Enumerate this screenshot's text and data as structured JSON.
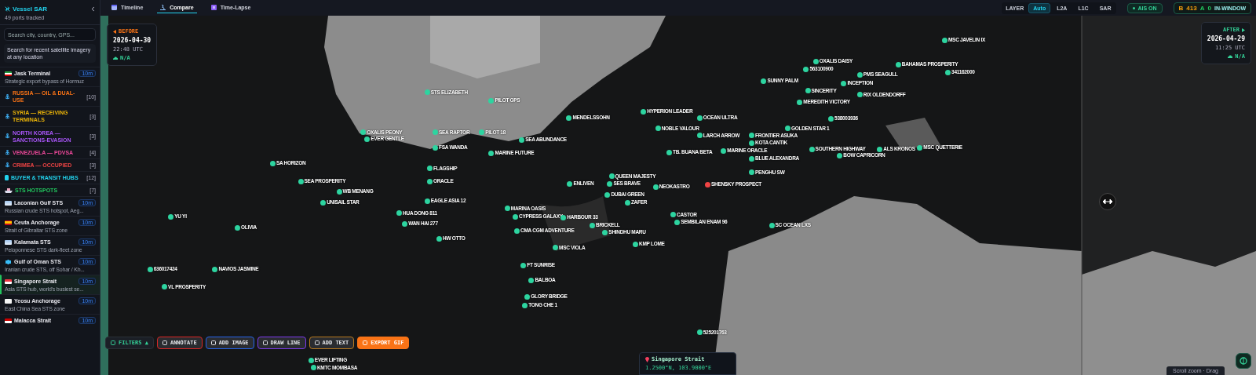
{
  "sidebar": {
    "title": "Vessel SAR",
    "subtitle": "49 ports tracked",
    "search": {
      "placeholder": "Search city, country, GPS..."
    },
    "hint": "Search for recent satellite imagery at any location",
    "items": [
      {
        "kind": "port",
        "name": "Jask Terminal",
        "description": "Strategic export bypass of Hormuz",
        "badge": "10m",
        "selected": false
      },
      {
        "kind": "group",
        "name": "RUSSIA — OIL & DUAL-USE",
        "count": "[10]",
        "color": "#f97316"
      },
      {
        "kind": "group",
        "name": "SYRIA — RECEIVING TERMINALS",
        "count": "[3]",
        "color": "#eab308"
      },
      {
        "kind": "group",
        "name": "NORTH KOREA — SANCTIONS-EVASION",
        "count": "[3]",
        "color": "#a855f7"
      },
      {
        "kind": "group",
        "name": "VENEZUELA — PDVSA",
        "count": "[4]",
        "color": "#ec4899"
      },
      {
        "kind": "group",
        "name": "CRIMEA — OCCUPIED",
        "count": "[3]",
        "color": "#ef4444"
      },
      {
        "kind": "hub",
        "name": "BUYER & TRANSIT HUBS",
        "count": "[12]",
        "color": "#22d3ee"
      },
      {
        "kind": "hotspot",
        "name": "STS HOTSPOTS",
        "count": "[7]",
        "color": "#22c55e"
      },
      {
        "kind": "port",
        "name": "Laconian Gulf STS",
        "description": "Russian crude STS hotspot, Aeg...",
        "badge": "10m",
        "selected": false
      },
      {
        "kind": "port",
        "name": "Ceuta Anchorage",
        "description": "Strait of Gibraltar STS zone",
        "badge": "10m",
        "selected": false
      },
      {
        "kind": "port",
        "name": "Kalamata STS",
        "description": "Peloponnese STS dark-fleet zone",
        "badge": "10m",
        "selected": false
      },
      {
        "kind": "port",
        "name": "Gulf of Oman STS",
        "description": "Iranian crude STS, off Sohar / Kh...",
        "badge": "10m",
        "selected": false
      },
      {
        "kind": "port",
        "name": "Singapore Strait",
        "description": "Asia STS hub, world's busiest se...",
        "badge": "10m",
        "selected": true
      },
      {
        "kind": "port",
        "name": "Yeosu Anchorage",
        "description": "East China Sea STS zone",
        "badge": "10m",
        "selected": false
      },
      {
        "kind": "port",
        "name": "Malacca Strait",
        "badge": "10m",
        "selected": false
      }
    ]
  },
  "tabs": [
    {
      "label": "Timeline",
      "selected": false
    },
    {
      "label": "Compare",
      "selected": true
    },
    {
      "label": "Time-Lapse",
      "selected": false
    }
  ],
  "layer": {
    "label": "LAYER",
    "options": [
      {
        "label": "Auto",
        "selected": true
      },
      {
        "label": "L2A",
        "selected": false
      },
      {
        "label": "L1C",
        "selected": false
      },
      {
        "label": "SAR",
        "selected": false
      }
    ]
  },
  "ais": {
    "label": "AIS ON",
    "on": true
  },
  "counts": [
    {
      "label": "B",
      "value": "413",
      "color": "#f59e0b"
    },
    {
      "label": "A",
      "value": "0",
      "color": "#22c55e"
    }
  ],
  "counts_label": "IN-WINDOW",
  "before": {
    "label": "BEFORE",
    "date": "2026-04-30",
    "time": "22:48 UTC",
    "cloud": "N/A"
  },
  "after": {
    "label": "AFTER",
    "date": "2026-04-29",
    "time": "11:25 UTC",
    "cloud": "N/A"
  },
  "vessels": [
    {
      "name": "MSC JAVELIN IX",
      "color": "#2dd4a0"
    },
    {
      "name": "OXALIS DAISY",
      "color": "#2dd4a0"
    },
    {
      "name": "BAHAMAS PROSPERITY",
      "color": "#2dd4a0"
    },
    {
      "name": "563100900",
      "color": "#2dd4a0"
    },
    {
      "name": "PMS SEAGULL",
      "color": "#2dd4a0"
    },
    {
      "name": "341162000",
      "color": "#2dd4a0"
    },
    {
      "name": "SUNNY PALM",
      "color": "#2dd4a0"
    },
    {
      "name": "INCEPTION",
      "color": "#2dd4a0"
    },
    {
      "name": "STS ELIZABETH",
      "color": "#2dd4a0"
    },
    {
      "name": "SINCERITY",
      "color": "#2dd4a0"
    },
    {
      "name": "RIX OLDENDORFF",
      "color": "#2dd4a0"
    },
    {
      "name": "PILOT GPS",
      "color": "#2dd4a0"
    },
    {
      "name": "MEREDITH VICTORY",
      "color": "#2dd4a0"
    },
    {
      "name": "HYPERION LEADER",
      "color": "#2dd4a0"
    },
    {
      "name": "MENDELSSOHN",
      "color": "#2dd4a0"
    },
    {
      "name": "OCEAN ULTRA",
      "color": "#2dd4a0"
    },
    {
      "name": "538003936",
      "color": "#2dd4a0"
    },
    {
      "name": "NOBLE VALOUR",
      "color": "#2dd4a0"
    },
    {
      "name": "GOLDEN STAR 1",
      "color": "#2dd4a0"
    },
    {
      "name": "OXALIS PEONY",
      "color": "#2dd4a0"
    },
    {
      "name": "SEA RAPTOR",
      "color": "#2dd4a0"
    },
    {
      "name": "PILOT 18",
      "color": "#2dd4a0"
    },
    {
      "name": "LARCH ARROW",
      "color": "#2dd4a0"
    },
    {
      "name": "FRONTIER ASUKA",
      "color": "#2dd4a0"
    },
    {
      "name": "EVER GENTLE",
      "color": "#2dd4a0"
    },
    {
      "name": "SEA ABUNDANCE",
      "color": "#2dd4a0"
    },
    {
      "name": "KOTA CANTIK",
      "color": "#2dd4a0"
    },
    {
      "name": "FSA WANDA",
      "color": "#2dd4a0"
    },
    {
      "name": "MARINE FUTURE",
      "color": "#2dd4a0"
    },
    {
      "name": "TB. BUANA BETA",
      "color": "#2dd4a0"
    },
    {
      "name": "MARINE ORACLE",
      "color": "#2dd4a0"
    },
    {
      "name": "SOUTHERN HIGHWAY",
      "color": "#2dd4a0"
    },
    {
      "name": "ALS KRONOS",
      "color": "#2dd4a0"
    },
    {
      "name": "MSC QUETTERIE",
      "color": "#2dd4a0"
    },
    {
      "name": "BOW CAPRICORN",
      "color": "#2dd4a0"
    },
    {
      "name": "BLUE ALEXANDRA",
      "color": "#2dd4a0"
    },
    {
      "name": "SA HORIZON",
      "color": "#2dd4a0"
    },
    {
      "name": "FLAGSHIP",
      "color": "#2dd4a0"
    },
    {
      "name": "PENGHU SW",
      "color": "#2dd4a0"
    },
    {
      "name": "QUEEN MAJESTY",
      "color": "#2dd4a0"
    },
    {
      "name": "SEA PROSPERITY",
      "color": "#2dd4a0"
    },
    {
      "name": "ORACLE",
      "color": "#2dd4a0"
    },
    {
      "name": "ENLIVEN",
      "color": "#2dd4a0"
    },
    {
      "name": "SES BRAVE",
      "color": "#2dd4a0"
    },
    {
      "name": "NEOKASTRO",
      "color": "#2dd4a0"
    },
    {
      "name": "SHENSKY PROSPECT",
      "color": "#ef4444"
    },
    {
      "name": "WB MENANG",
      "color": "#2dd4a0"
    },
    {
      "name": "DUBAI GREEN",
      "color": "#2dd4a0"
    },
    {
      "name": "UNISAIL STAR",
      "color": "#2dd4a0"
    },
    {
      "name": "EAGLE ASIA 12",
      "color": "#2dd4a0"
    },
    {
      "name": "ZAFER",
      "color": "#2dd4a0"
    },
    {
      "name": "MARINA OASIS",
      "color": "#2dd4a0"
    },
    {
      "name": "YU YI",
      "color": "#2dd4a0"
    },
    {
      "name": "HUA DONG 811",
      "color": "#2dd4a0"
    },
    {
      "name": "CYPRESS GALAXY",
      "color": "#2dd4a0"
    },
    {
      "name": "HARBOUR 33",
      "color": "#2dd4a0"
    },
    {
      "name": "CASTOR",
      "color": "#2dd4a0"
    },
    {
      "name": "OLIVIA",
      "color": "#2dd4a0"
    },
    {
      "name": "WAN HAI 277",
      "color": "#2dd4a0"
    },
    {
      "name": "BRICKELL",
      "color": "#2dd4a0"
    },
    {
      "name": "SEMBILAN ENAM 96",
      "color": "#2dd4a0"
    },
    {
      "name": "SC OCEAN LXS",
      "color": "#2dd4a0"
    },
    {
      "name": "CMA CGM ADVENTURE",
      "color": "#2dd4a0"
    },
    {
      "name": "SHINDHU MARU",
      "color": "#2dd4a0"
    },
    {
      "name": "HW OTTO",
      "color": "#2dd4a0"
    },
    {
      "name": "MSC VIOLA",
      "color": "#2dd4a0"
    },
    {
      "name": "KMP LOME",
      "color": "#2dd4a0"
    },
    {
      "name": "FT SUNRISE",
      "color": "#2dd4a0"
    },
    {
      "name": "636017424",
      "color": "#2dd4a0"
    },
    {
      "name": "NAVIOS JASMINE",
      "color": "#2dd4a0"
    },
    {
      "name": "BALBOA",
      "color": "#2dd4a0"
    },
    {
      "name": "VL PROSPERITY",
      "color": "#2dd4a0"
    },
    {
      "name": "GLORY BRIDGE",
      "color": "#2dd4a0"
    },
    {
      "name": "TONG CHE 1",
      "color": "#2dd4a0"
    },
    {
      "name": "525201763",
      "color": "#2dd4a0"
    },
    {
      "name": "EVER LIFTING",
      "color": "#2dd4a0"
    },
    {
      "name": "KMTC MOMBASA",
      "color": "#2dd4a0"
    }
  ],
  "tools": [
    {
      "kind": "filters",
      "label": "FILTERS ▲"
    },
    {
      "kind": "annotate",
      "label": "ANNOTATE"
    },
    {
      "kind": "image",
      "label": "ADD IMAGE"
    },
    {
      "kind": "line",
      "label": "DRAW LINE"
    },
    {
      "kind": "text",
      "label": "ADD TEXT"
    },
    {
      "kind": "export",
      "label": "EXPORT GIF"
    }
  ],
  "location": {
    "name": "Singapore Strait",
    "coords": "1.2500°N, 103.9000°E"
  },
  "hint": "Scroll zoom · Drag"
}
